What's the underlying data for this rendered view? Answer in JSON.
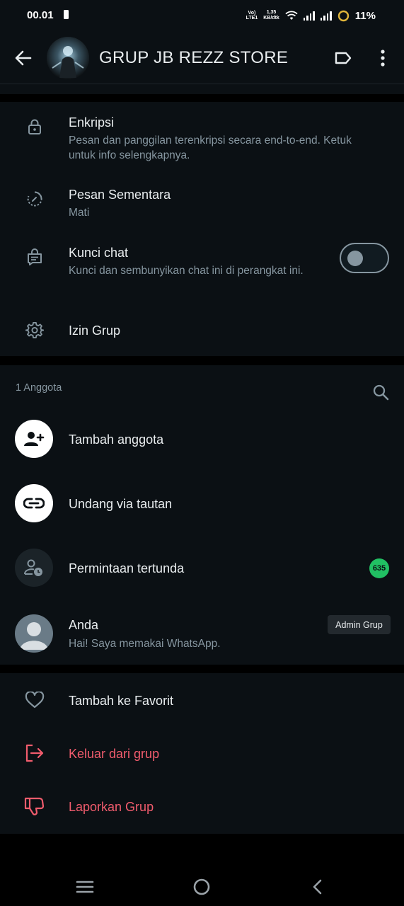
{
  "status_bar": {
    "time": "00.01",
    "volte_top": "Vo)",
    "volte_bottom": "LTE1",
    "speed_value": "1,35",
    "speed_unit": "KB/dtk",
    "battery_pct": "11%"
  },
  "header": {
    "title": "GRUP JB REZZ STORE"
  },
  "settings": {
    "encryption_title": "Enkripsi",
    "encryption_sub": "Pesan dan panggilan terenkripsi secara end-to-end. Ketuk untuk info selengkapnya.",
    "disappearing_title": "Pesan Sementara",
    "disappearing_sub": "Mati",
    "chatlock_title": "Kunci chat",
    "chatlock_sub": "Kunci dan sembunyikan chat ini di perangkat ini.",
    "chatlock_enabled": false,
    "permissions_title": "Izin Grup"
  },
  "members": {
    "count_label": "1 Anggota",
    "add_member": "Tambah anggota",
    "invite_link": "Undang via tautan",
    "pending_requests": "Permintaan tertunda",
    "pending_count": "635",
    "self_name": "Anda",
    "self_status": "Hai! Saya memakai WhatsApp.",
    "self_role": "Admin Grup"
  },
  "actions": {
    "favorite": "Tambah ke Favorit",
    "exit_group": "Keluar dari grup",
    "report_group": "Laporkan Grup"
  },
  "colors": {
    "background": "#0b1014",
    "accent_green": "#21c063",
    "danger_red": "#f15c6d",
    "secondary_text": "#8696a0"
  }
}
